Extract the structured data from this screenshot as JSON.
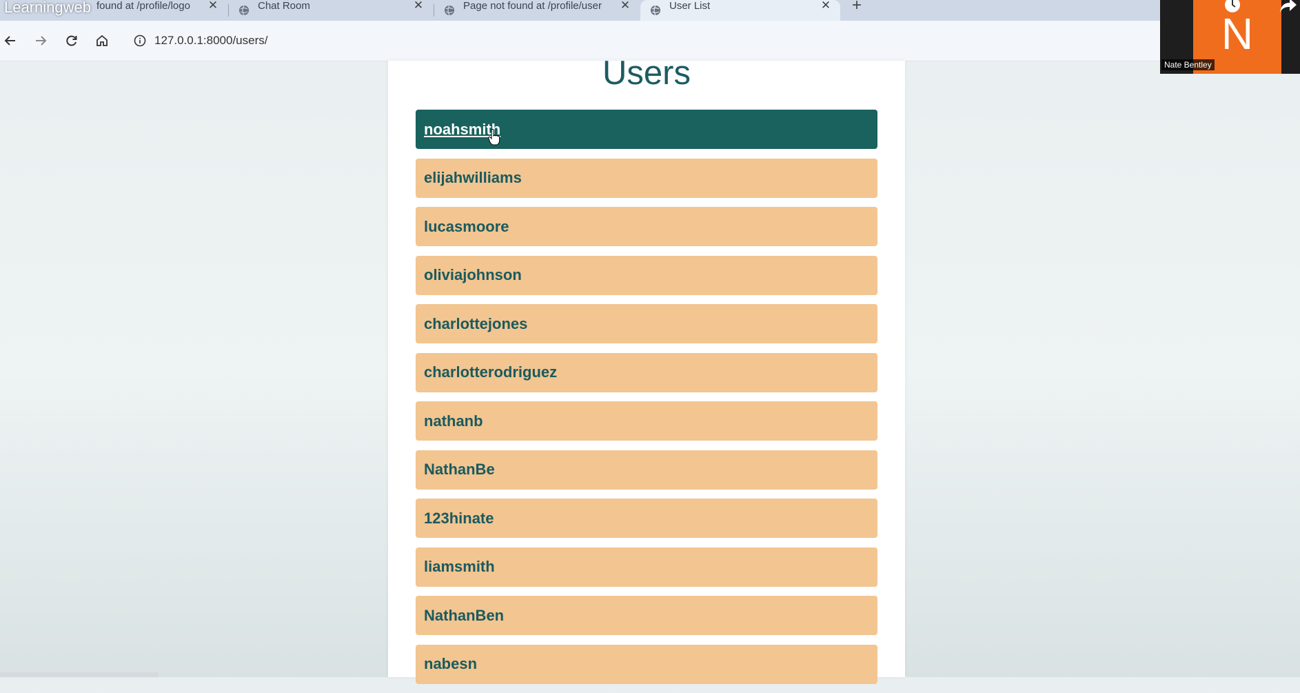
{
  "video_title": "Learningweb",
  "tabs": [
    {
      "title": "found at /profile/logo",
      "active": false
    },
    {
      "title": "Chat Room",
      "active": false
    },
    {
      "title": "Page not found at /profile/user",
      "active": false
    },
    {
      "title": "User List",
      "active": true
    }
  ],
  "address_bar": {
    "url": "127.0.0.1:8000/users/"
  },
  "webcam": {
    "letter": "N",
    "name": "Nate Bentley",
    "tile_color": "#f06d1d"
  },
  "page": {
    "title": "Users",
    "users": [
      {
        "name": "noahsmith",
        "selected": true
      },
      {
        "name": "elijahwilliams"
      },
      {
        "name": "lucasmoore"
      },
      {
        "name": "oliviajohnson"
      },
      {
        "name": "charlottejones"
      },
      {
        "name": "charlotterodriguez"
      },
      {
        "name": "nathanb"
      },
      {
        "name": "NathanBe"
      },
      {
        "name": "123hinate"
      },
      {
        "name": "liamsmith"
      },
      {
        "name": "NathanBen"
      },
      {
        "name": "nabesn"
      }
    ]
  },
  "colors": {
    "title": "#1b5c62",
    "user_item_bg": "#f2c591",
    "user_item_selected_bg": "#19625e",
    "user_text": "#1a5a5e"
  }
}
